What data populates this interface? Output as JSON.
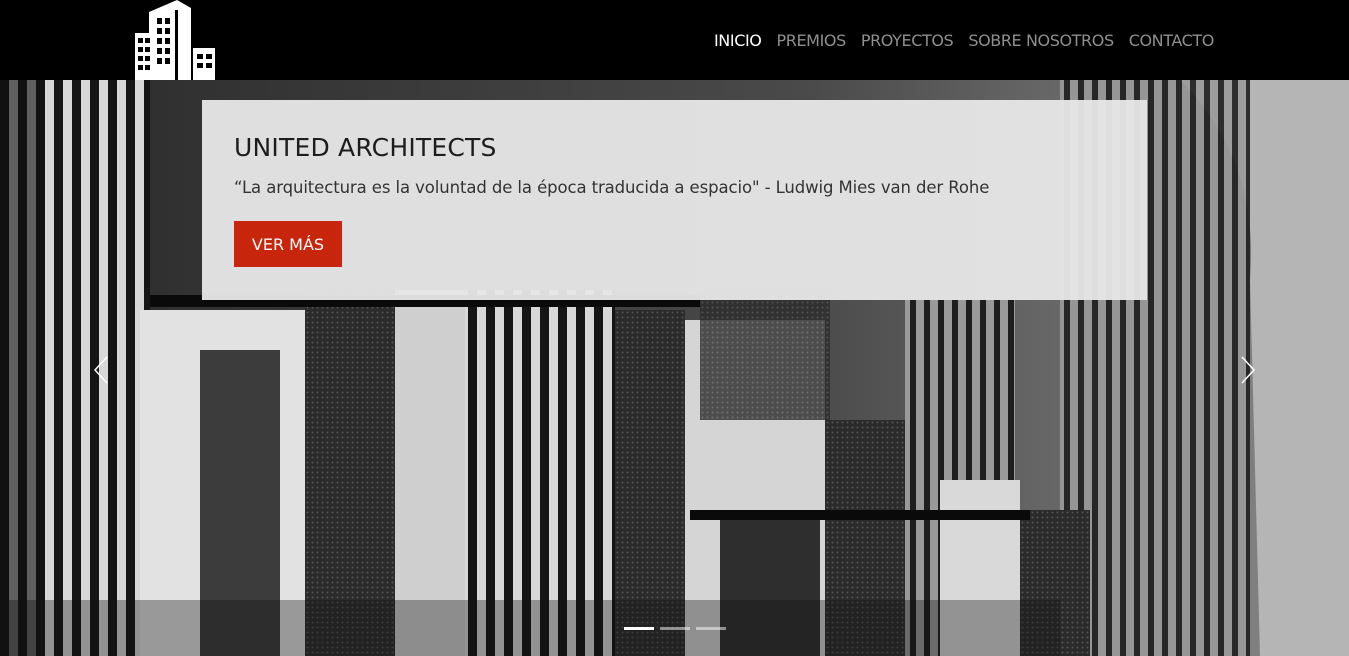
{
  "navbar": {
    "logo_icon": "building-logo-icon",
    "items": [
      {
        "label": "INICIO",
        "active": true
      },
      {
        "label": "PREMIOS",
        "active": false
      },
      {
        "label": "PROYECTOS",
        "active": false
      },
      {
        "label": "SOBRE NOSOTROS",
        "active": false
      },
      {
        "label": "CONTACTO",
        "active": false
      }
    ]
  },
  "hero": {
    "title": "UNITED ARCHITECTS",
    "quote": "“La arquitectura es la voluntad de la época traducida a espacio\" - Ludwig Mies van der Rohe",
    "button_label": "VER MÁS",
    "prev_icon": "chevron-left-icon",
    "next_icon": "chevron-right-icon",
    "slides_count": 3,
    "active_slide": 1
  },
  "colors": {
    "nav_bg": "#000000",
    "nav_active": "#ffffff",
    "nav_inactive": "#8f8f8f",
    "accent": "#c8250d",
    "card_bg": "#e6e6e6"
  }
}
